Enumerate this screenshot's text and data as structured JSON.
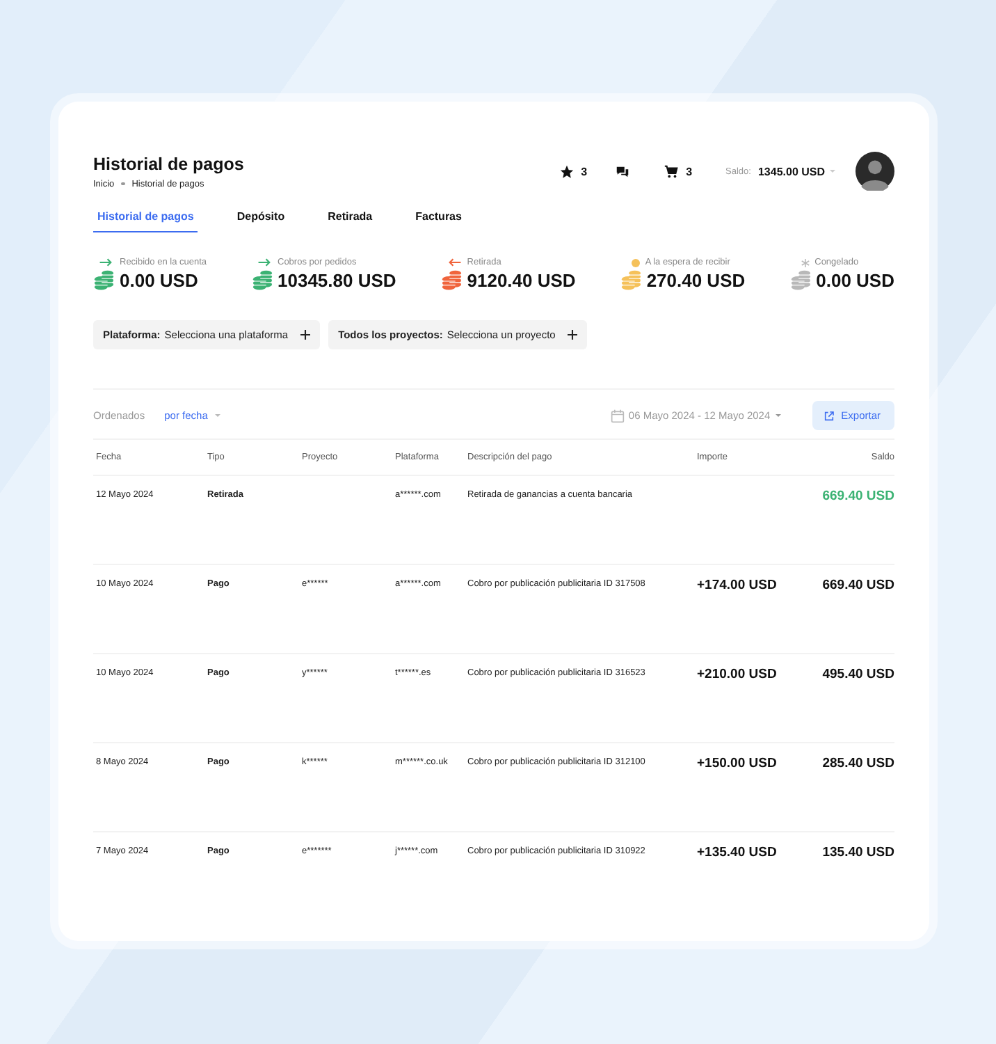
{
  "header": {
    "title": "Historial de pagos",
    "breadcrumb": [
      "Inicio",
      "Historial de pagos"
    ],
    "favorites_count": "3",
    "cart_count": "3",
    "balance_label": "Saldo:",
    "balance_value": "1345.00 USD"
  },
  "tabs": [
    {
      "label": "Historial de pagos",
      "selected": true
    },
    {
      "label": "Depósito",
      "selected": false
    },
    {
      "label": "Retirada",
      "selected": false
    },
    {
      "label": "Facturas",
      "selected": false
    }
  ],
  "stats": [
    {
      "label": "Recibido en la cuenta",
      "value": "0.00 USD",
      "kind": "in",
      "color": "#3bb273"
    },
    {
      "label": "Cobros por pedidos",
      "value": "10345.80 USD",
      "kind": "in",
      "color": "#3bb273"
    },
    {
      "label": "Retirada",
      "value": "9120.40 USD",
      "kind": "out",
      "color": "#f0643c"
    },
    {
      "label": "A la espera de recibir",
      "value": "270.40 USD",
      "kind": "pending",
      "color": "#f5c15a"
    },
    {
      "label": "Congelado",
      "value": "0.00 USD",
      "kind": "frozen",
      "color": "#b8b8b8"
    }
  ],
  "filters": [
    {
      "label": "Plataforma:",
      "value": "Selecciona una plataforma"
    },
    {
      "label": "Todos los proyectos:",
      "value": "Selecciona un proyecto"
    }
  ],
  "sort": {
    "label": "Ordenados",
    "value": "por fecha"
  },
  "date_range": "06 Mayo 2024 - 12 Mayo 2024",
  "export_button": "Exportar",
  "table": {
    "columns": [
      "Fecha",
      "Tipo",
      "Proyecto",
      "Plataforma",
      "Descripción del pago",
      "Importe",
      "Saldo"
    ],
    "rows": [
      {
        "kind": "withdrawal",
        "date": "12 Mayo 2024",
        "type": "Retirada",
        "platform": "a******.com",
        "description": "Retirada de ganancias a cuenta bancaria",
        "balance": "669.40 USD"
      },
      {
        "kind": "payment",
        "date": "10 Mayo 2024",
        "type": "Pago",
        "project": "e******",
        "platform": "a******.com",
        "description": "Cobro por publicación publicitaria ID 317508",
        "amount": "+174.00 USD",
        "balance": "669.40 USD"
      },
      {
        "kind": "payment",
        "date": "10 Mayo 2024",
        "type": "Pago",
        "project": "y******",
        "platform": "t******.es",
        "description": "Cobro por publicación publicitaria ID 316523",
        "amount": "+210.00 USD",
        "balance": "495.40 USD"
      },
      {
        "kind": "payment",
        "date": "8 Mayo 2024",
        "type": "Pago",
        "project": "k******",
        "platform": "m******.co.uk",
        "description": "Cobro por publicación publicitaria ID 312100",
        "amount": "+150.00 USD",
        "balance": "285.40 USD"
      },
      {
        "kind": "payment",
        "date": "7 Mayo 2024",
        "type": "Pago",
        "project": "e*******",
        "platform": "j******.com",
        "description": "Cobro por publicación publicitaria ID 310922",
        "amount": "+135.40 USD",
        "balance": "135.40 USD"
      }
    ]
  }
}
